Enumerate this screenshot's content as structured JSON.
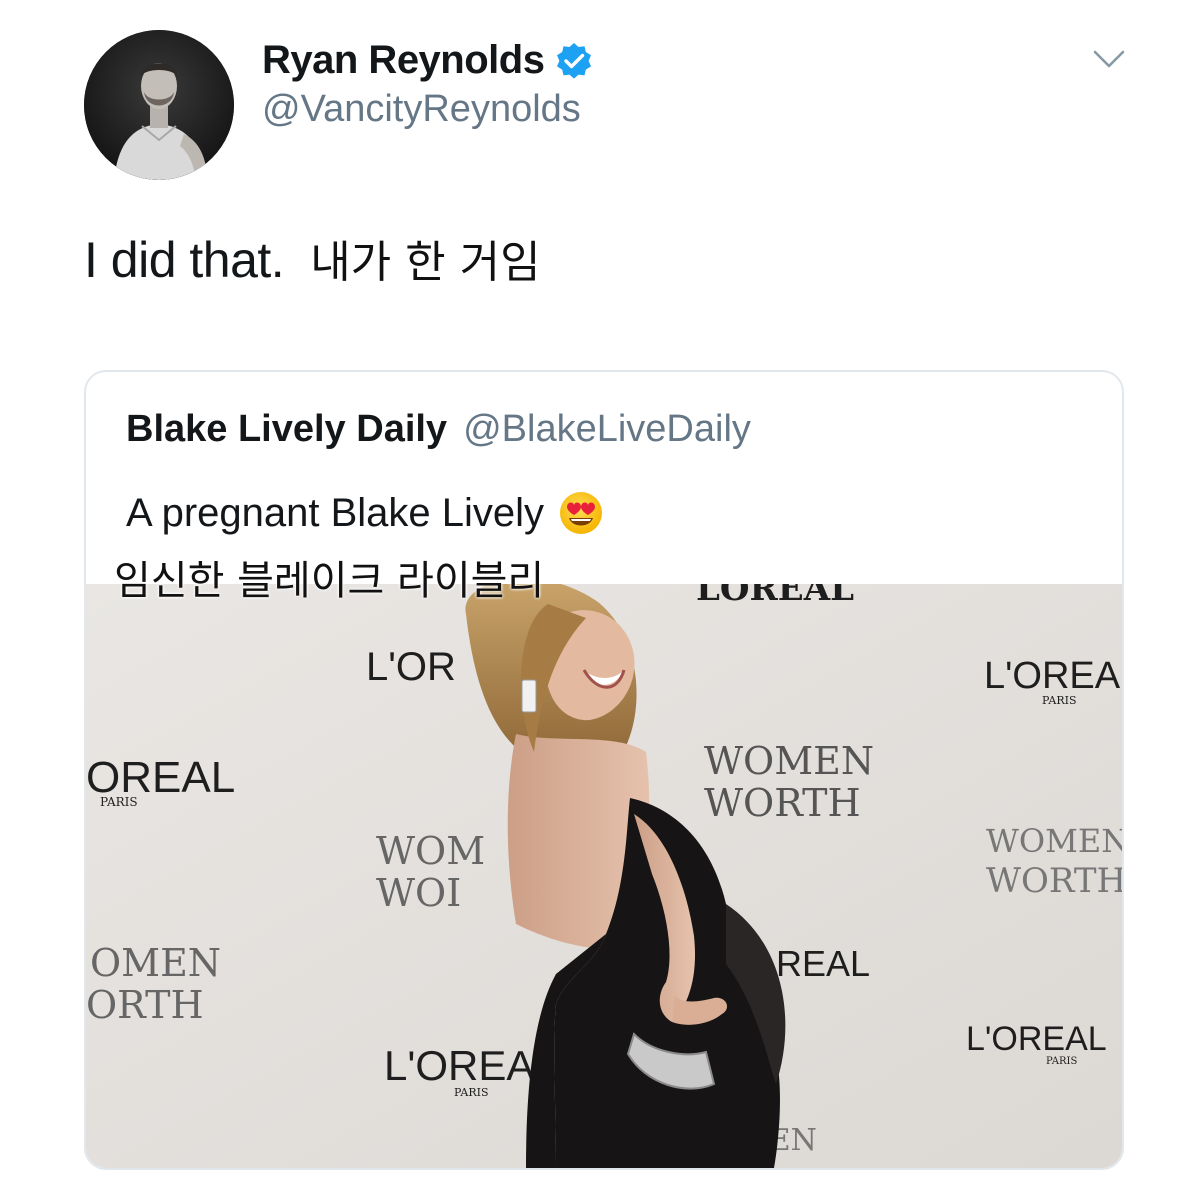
{
  "tweet": {
    "author_name": "Ryan Reynolds",
    "author_handle": "@VancityReynolds",
    "text_en": "I did that.",
    "text_ko": "내가 한 거임",
    "icons": [
      "avatar",
      "verified-badge-icon",
      "chevron-down-icon"
    ]
  },
  "quoted_tweet": {
    "author_name": "Blake Lively Daily",
    "author_handle": "@BlakeLiveDaily",
    "text_en": "A pregnant Blake Lively",
    "emoji": "heart-eyes-emoji",
    "caption_ko": "임신한 블레이크 라이블리",
    "photo": {
      "subject": "woman in black backless dress posing at L'Oréal Women of Worth backdrop",
      "backdrop_texts": [
        "L'OREAL",
        "PARIS",
        "L'OR",
        "L'OREA",
        "OREAL",
        "WOMEN of WORTH",
        "WOM",
        "WOI",
        "OMEN of",
        "ORTH",
        "REAL",
        "L'OREA",
        "L'OREAL",
        "WOMEN",
        "WORTH"
      ]
    }
  },
  "colors": {
    "text_primary": "#14171a",
    "text_secondary": "#657786",
    "verified_blue": "#1da1f2",
    "card_border": "#e1e8ed",
    "backdrop": "#e6e3e0",
    "dress": "#151313",
    "hair": "#b98e55"
  }
}
